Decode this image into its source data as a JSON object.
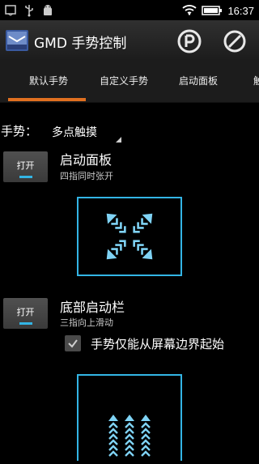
{
  "status_bar": {
    "time": "16:37"
  },
  "header": {
    "title": "GMD 手势控制"
  },
  "tabs": [
    {
      "label": "默认手势",
      "selected": true
    },
    {
      "label": "自定义手势",
      "selected": false
    },
    {
      "label": "启动面板",
      "selected": false
    },
    {
      "label": "触",
      "selected": false
    }
  ],
  "gesture": {
    "label": "手势：",
    "value": "多点触摸"
  },
  "items": [
    {
      "toggle_label": "打开",
      "title": "启动面板",
      "subtitle": "四指同时张开"
    },
    {
      "toggle_label": "打开",
      "title": "底部启动栏",
      "subtitle": "三指向上滑动",
      "checkbox": {
        "label": "手势仅能从屏幕边界起始",
        "checked": true
      }
    }
  ],
  "colors": {
    "accent_blue": "#33b5e5",
    "tab_indicator": "#e07020"
  }
}
